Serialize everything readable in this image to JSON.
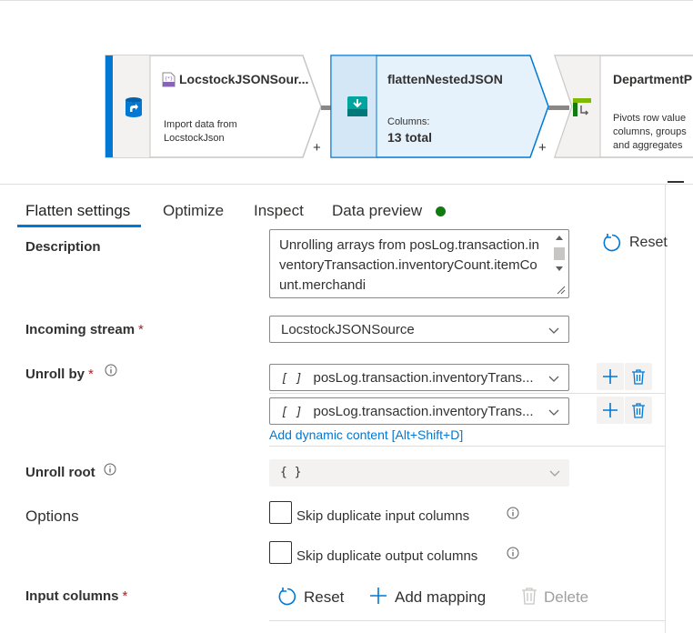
{
  "pipeline": {
    "nodes": [
      {
        "title": "LocstockJSONSour...",
        "desc_line1": "Import data from",
        "desc_line2": "LocstockJson",
        "plus": "+"
      },
      {
        "title": "flattenNestedJSON",
        "desc_line1": "Columns:",
        "desc_line2": "13 total",
        "plus": "+"
      },
      {
        "title": "DepartmentP",
        "desc_line1": "Pivots row value",
        "desc_line2": "columns, groups",
        "desc_line3": "and aggregates"
      }
    ],
    "source_icon_text": "{*}"
  },
  "tabs": [
    {
      "label": "Flatten settings",
      "active": true
    },
    {
      "label": "Optimize"
    },
    {
      "label": "Inspect"
    },
    {
      "label": "Data preview",
      "status_color": "#107c10"
    }
  ],
  "form": {
    "description": {
      "label": "Description",
      "value": "Unrolling arrays from posLog.transaction.inventoryTransaction.inventoryCount.itemCount.merchandi",
      "reset_label": "Reset"
    },
    "incoming_stream": {
      "label": "Incoming stream",
      "required": "*",
      "value": "LocstockJSONSource"
    },
    "unroll_by": {
      "label": "Unroll by",
      "required": "*",
      "rows": [
        {
          "bracket": "[ ]",
          "value": "posLog.transaction.inventoryTrans..."
        },
        {
          "bracket": "[ ]",
          "value": "posLog.transaction.inventoryTrans..."
        }
      ],
      "dynamic_link": "Add dynamic content [Alt+Shift+D]"
    },
    "unroll_root": {
      "label": "Unroll root",
      "value": "{ }"
    },
    "options": {
      "label": "Options",
      "skip_input": "Skip duplicate input columns",
      "skip_output": "Skip duplicate output columns"
    },
    "input_columns": {
      "label": "Input columns",
      "required": "*",
      "reset_label": "Reset",
      "add_mapping_label": "Add mapping",
      "delete_label": "Delete"
    }
  },
  "colors": {
    "accent": "#0078d4",
    "required": "#a4262c",
    "status_green": "#107c10",
    "node_selected_fill": "#e6f2fb"
  }
}
